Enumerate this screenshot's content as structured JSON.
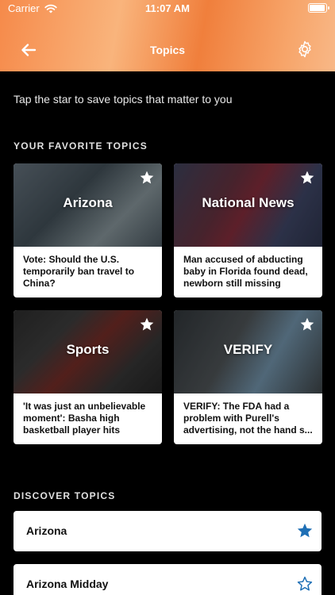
{
  "status_bar": {
    "carrier": "Carrier",
    "time": "11:07 AM",
    "battery_level": 1.0
  },
  "nav": {
    "title": "Topics",
    "back_icon": "back-arrow-icon",
    "settings_icon": "gear-icon"
  },
  "intro": "Tap the star to save topics that matter to you",
  "favorites": {
    "section_title": "YOUR FAVORITE TOPICS",
    "cards": [
      {
        "name": "Arizona",
        "headline": "Vote: Should the U.S. temporarily ban travel to China?",
        "starred": true
      },
      {
        "name": "National News",
        "headline": "Man accused of abducting baby in Florida found dead, newborn still missing",
        "starred": true
      },
      {
        "name": "Sports",
        "headline": "'It was just an unbelievable moment': Basha high basketball player hits game...",
        "starred": true
      },
      {
        "name": "VERIFY",
        "headline": "VERIFY: The FDA had a problem with Purell's advertising, not the hand s...",
        "starred": true
      }
    ]
  },
  "discover": {
    "section_title": "DISCOVER TOPICS",
    "items": [
      {
        "label": "Arizona",
        "starred": true
      },
      {
        "label": "Arizona Midday",
        "starred": false
      }
    ]
  },
  "colors": {
    "accent": "#1e6fb5",
    "header_orange": "#f68a4a"
  }
}
